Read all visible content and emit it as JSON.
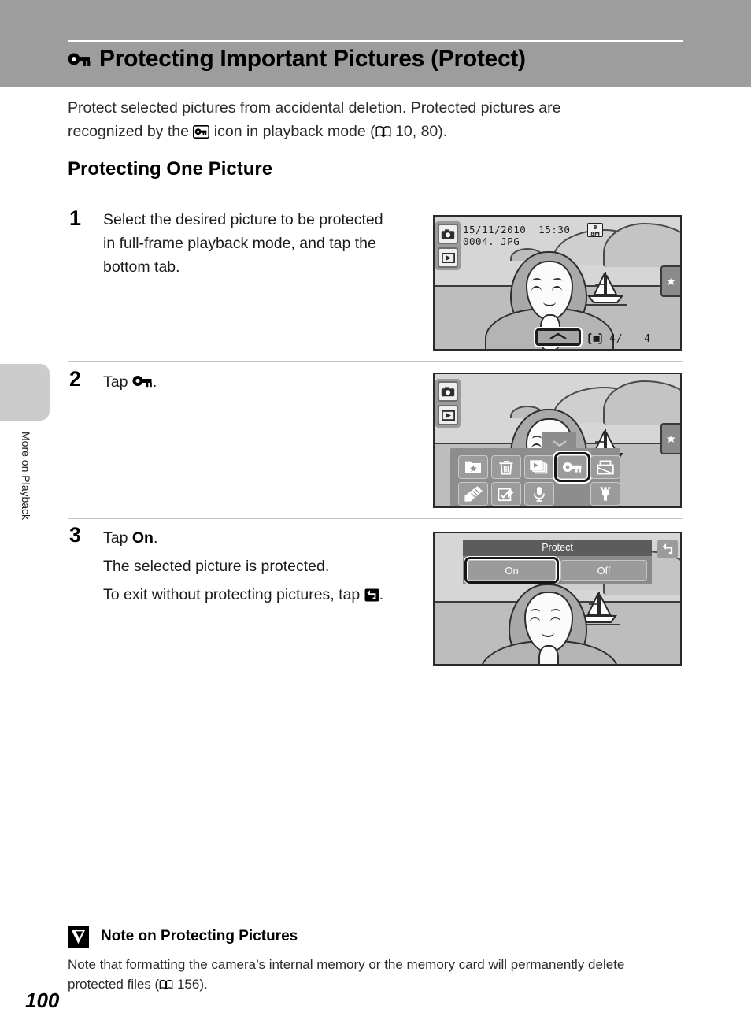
{
  "header": {
    "icon": "protect-key-icon",
    "title": "Protecting Important Pictures (Protect)"
  },
  "intro": {
    "line1": "Protect selected pictures from accidental deletion. Protected pictures are",
    "line2_pre": "recognized by the",
    "line2_mid": "icon in playback mode (",
    "line2_ref": "10, 80).",
    "ref_icon": "book-icon",
    "protect_icon": "protect-circle-key-icon"
  },
  "section": {
    "heading": "Protecting One Picture"
  },
  "steps": [
    {
      "number": "1",
      "text": "Select the desired picture to be protected in full-frame playback mode, and tap the bottom tab."
    },
    {
      "number": "2",
      "text_pre": "Tap",
      "text_post": ".",
      "icon": "protect-key-icon"
    },
    {
      "number": "3",
      "text_pre": "Tap",
      "text_bold": "On",
      "text_post": ".",
      "sub1": "The selected picture is protected.",
      "sub2_pre": "To exit without protecting pictures, tap",
      "sub2_post": ".",
      "back_icon": "back-arrow-icon"
    }
  ],
  "screen1": {
    "date": "15/11/2010  15:30",
    "filename": "0004. JPG",
    "quality_badge_line1": "8",
    "quality_badge_line2": "8M",
    "memory_icon": "internal-memory-icon",
    "counter": "4/   4",
    "shooting_mode_icon": "camera-icon",
    "playback_mode_icon": "playback-icon",
    "favorites_tab_icon": "star-icon",
    "bottom_tab_icon": "chevron-up-icon"
  },
  "screen2": {
    "shooting_mode_icon": "camera-icon",
    "playback_mode_icon": "playback-icon",
    "favorites_tab_icon": "star-icon",
    "menu_items": [
      {
        "name": "favorite-pictures-icon",
        "selected": false
      },
      {
        "name": "delete-trash-icon",
        "selected": false
      },
      {
        "name": "slide-show-icon",
        "selected": false
      },
      {
        "name": "protect-key-icon",
        "selected": true
      },
      {
        "name": "print-order-icon",
        "selected": false
      },
      {
        "name": "paint-retouch-icon",
        "selected": false
      },
      {
        "name": "quick-retouch-icon",
        "selected": false
      },
      {
        "name": "voice-memo-icon",
        "selected": false
      },
      {
        "name": "setup-wrench-icon",
        "selected": false
      }
    ]
  },
  "screen3": {
    "dialog_title": "Protect",
    "option_on": "On",
    "option_off": "Off",
    "selected_option": "On",
    "back_icon": "back-arrow-icon"
  },
  "margin": {
    "section_label": "More on Playback"
  },
  "note": {
    "icon": "caution-check-icon",
    "title": "Note on Protecting Pictures",
    "line1": "Note that formatting the camera’s internal memory or the memory card will permanently delete",
    "line2": "protected files (",
    "line2_ref": "156).",
    "ref_icon": "book-icon"
  },
  "footer": {
    "page_number": "100"
  },
  "colors": {
    "header_band": "#9d9d9d",
    "divider": "#c6c6c6",
    "margin_tab": "#cccccc",
    "lcd_border": "#2a2a2a",
    "lcd_sky": "#d6d6d6",
    "lcd_sea": "#bdbdbd"
  }
}
